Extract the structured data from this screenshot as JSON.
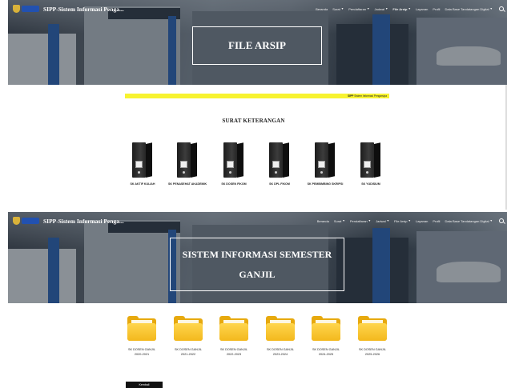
{
  "colors": {
    "marquee_bg": "#f7f330",
    "logo_word": "#2251b0",
    "folder": "#f3b81d",
    "binder": "#1c1c1c",
    "back_button": "#111111"
  },
  "brand": {
    "title": "SIPP-Sistem Informasi Penga...",
    "logo_icon": "university-crest-icon"
  },
  "nav": {
    "items": [
      {
        "label": "Beranda",
        "dropdown": false,
        "active": false
      },
      {
        "label": "Surat",
        "dropdown": true,
        "active": false
      },
      {
        "label": "Pendaftaran",
        "dropdown": true,
        "active": false
      },
      {
        "label": "Jadwal",
        "dropdown": true,
        "active": false
      },
      {
        "label": "File Arsip",
        "dropdown": true,
        "active": true
      },
      {
        "label": "Layanan",
        "dropdown": false,
        "active": false
      },
      {
        "label": "Profil",
        "dropdown": false,
        "active": false
      },
      {
        "label": "Data Base Tandatangan Digital",
        "dropdown": true,
        "active": false
      }
    ],
    "search_icon": "search-icon"
  },
  "screen1": {
    "hero_title": "FILE ARSIP",
    "marquee": {
      "bold": "SIPP",
      "text": " Sistem Informasi Pengarsipa"
    },
    "section_title": "SURAT KETERANGAN",
    "binders": [
      {
        "label": "SK AKTIF KULIAH"
      },
      {
        "label": "SK PENASEHAT AKADEMIK"
      },
      {
        "label": "SK DOSEN FIKOM"
      },
      {
        "label": "SK DPL FIKOM"
      },
      {
        "label": "SK PEMBIMBING SKRIPSI"
      },
      {
        "label": "SK YUDISIUM"
      }
    ]
  },
  "screen2": {
    "hero_title": "SISTEM INFORMASI SEMESTER GANJIL",
    "folders": [
      {
        "label_line1": "SK DOSEN GANJIL",
        "label_line2": "2020-2021"
      },
      {
        "label_line1": "SK DOSEN GANJIL",
        "label_line2": "2021-2022"
      },
      {
        "label_line1": "SK DOSEN GANJIL",
        "label_line2": "2022-2023"
      },
      {
        "label_line1": "SK DOSEN GANJIL",
        "label_line2": "2023-2024"
      },
      {
        "label_line1": "SK DOSEN GANJIL",
        "label_line2": "2024-2025"
      },
      {
        "label_line1": "SK DOSEN GANJIL",
        "label_line2": "2025-2026"
      }
    ],
    "back_label": "Kembali"
  }
}
